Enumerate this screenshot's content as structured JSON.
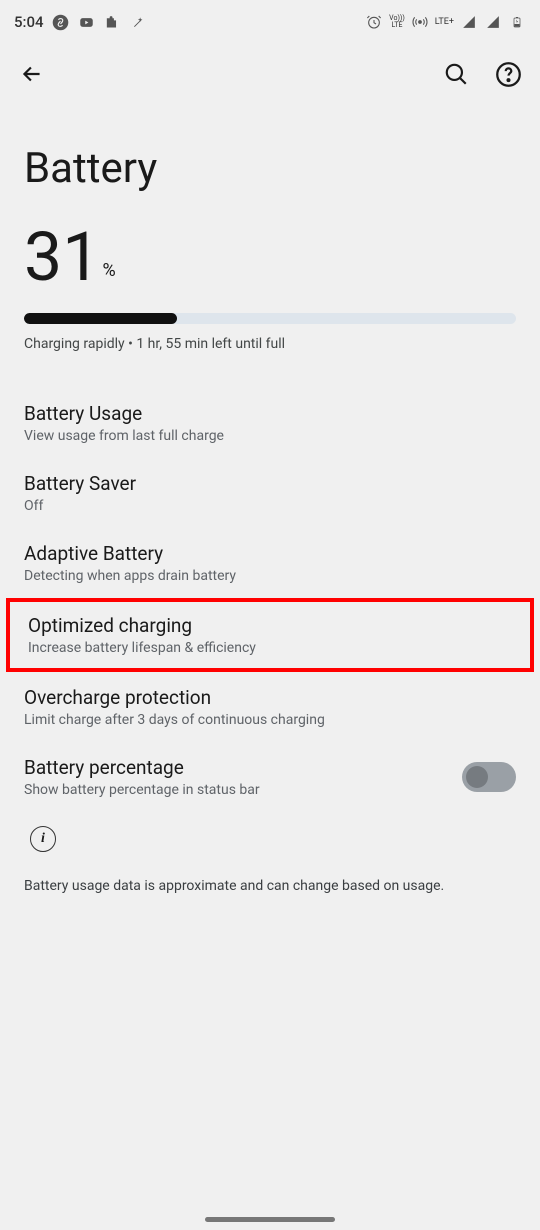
{
  "status_bar": {
    "time": "5:04",
    "network_label": "LTE+",
    "volte_label": "Vo\nLTE"
  },
  "page": {
    "title": "Battery"
  },
  "battery": {
    "percent": "31",
    "percent_sign": "%",
    "progress": 31,
    "status": "Charging rapidly • 1 hr, 55 min left until full"
  },
  "items": {
    "usage": {
      "title": "Battery Usage",
      "sub": "View usage from last full charge"
    },
    "saver": {
      "title": "Battery Saver",
      "sub": "Off"
    },
    "adaptive": {
      "title": "Adaptive Battery",
      "sub": "Detecting when apps drain battery"
    },
    "optimized": {
      "title": "Optimized charging",
      "sub": "Increase battery lifespan & efficiency"
    },
    "overcharge": {
      "title": "Overcharge protection",
      "sub": "Limit charge after 3 days of continuous charging"
    },
    "percentage": {
      "title": "Battery percentage",
      "sub": "Show battery percentage in status bar",
      "toggle": false
    }
  },
  "disclaimer": "Battery usage data is approximate and can change based on usage."
}
